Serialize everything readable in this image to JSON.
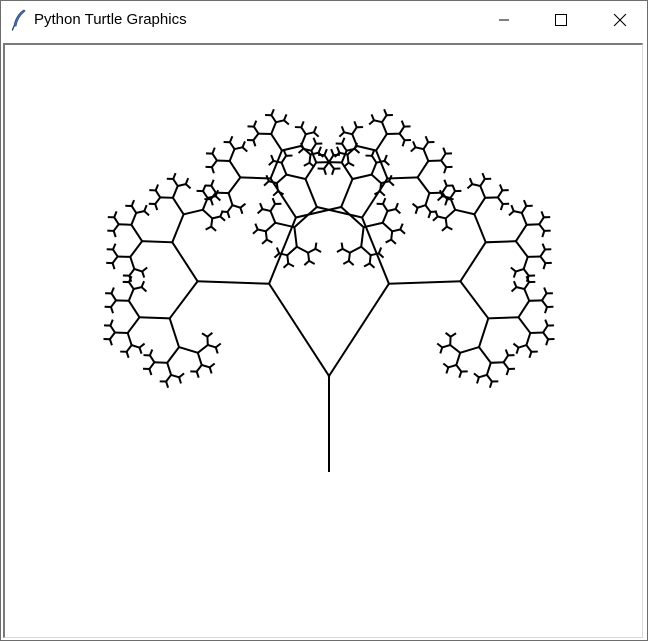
{
  "window": {
    "title": "Python Turtle Graphics",
    "controls": {
      "minimize_icon": "minimize-icon",
      "maximize_icon": "maximize-icon",
      "close_icon": "close-icon"
    }
  },
  "canvas": {
    "background": "#ffffff",
    "pen_color": "#000000",
    "drawing": {
      "shape": "fractal-tree",
      "levels": 8,
      "trunk_length": 95,
      "branch_angle_degrees": 30,
      "length_ratio": 0.65
    }
  }
}
